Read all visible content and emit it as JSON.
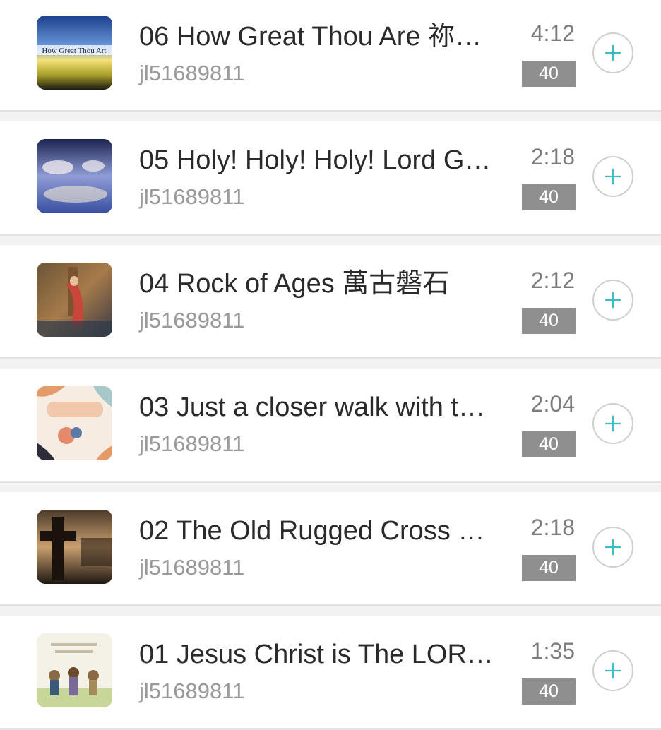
{
  "songs": [
    {
      "title": "06 How Great Thou Are 祢…",
      "author": "jl51689811",
      "duration": "4:12",
      "badge": "40",
      "thumb_text": "How Great Thou Art"
    },
    {
      "title": "05 Holy! Holy! Holy! Lord G…",
      "author": "jl51689811",
      "duration": "2:18",
      "badge": "40"
    },
    {
      "title": "04 Rock of Ages 萬古磐石",
      "author": "jl51689811",
      "duration": "2:12",
      "badge": "40"
    },
    {
      "title": "03 Just a closer walk with t…",
      "author": "jl51689811",
      "duration": "2:04",
      "badge": "40"
    },
    {
      "title": "02 The Old Rugged Cross …",
      "author": "jl51689811",
      "duration": "2:18",
      "badge": "40"
    },
    {
      "title": "01 Jesus Christ is The LOR…",
      "author": "jl51689811",
      "duration": "1:35",
      "badge": "40"
    }
  ],
  "icons": {
    "add": "plus-circle-icon"
  },
  "colors": {
    "accent": "#3bbfc4",
    "badge_bg": "#8f8f8f"
  }
}
